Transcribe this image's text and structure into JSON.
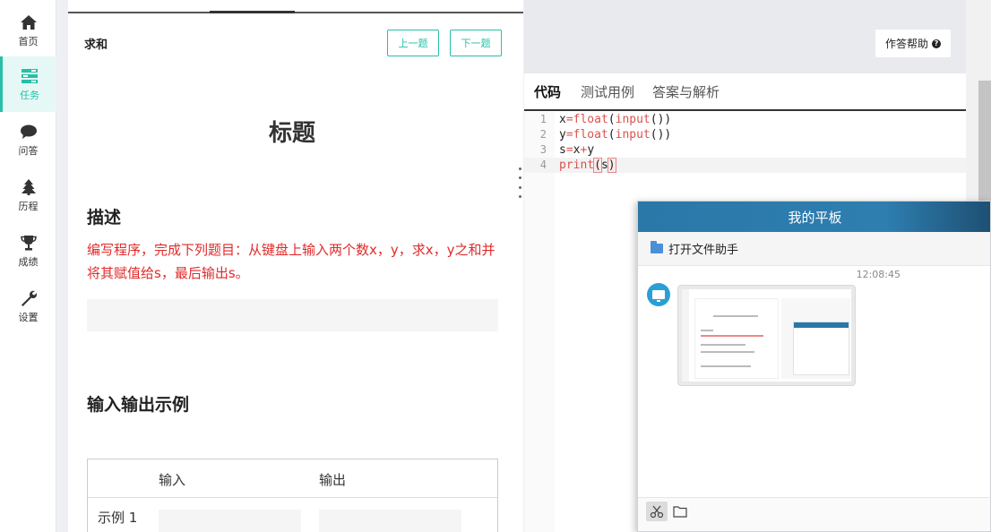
{
  "sidebar": {
    "items": [
      {
        "label": "首页",
        "icon": "home-icon"
      },
      {
        "label": "任务",
        "icon": "tasks-icon",
        "active": true
      },
      {
        "label": "问答",
        "icon": "chat-icon"
      },
      {
        "label": "历程",
        "icon": "tree-icon"
      },
      {
        "label": "成绩",
        "icon": "trophy-icon"
      },
      {
        "label": "设置",
        "icon": "wrench-icon"
      }
    ]
  },
  "problem": {
    "title": "求和",
    "prev_label": "上一题",
    "next_label": "下一题",
    "heading": "标题",
    "desc_heading": "描述",
    "description": "编写程序，完成下列题目：从键盘上输入两个数x，y，求x，y之和并将其赋值给s，最后输出s。",
    "io_heading": "输入输出示例",
    "table": {
      "input_header": "输入",
      "output_header": "输出",
      "row_label": "示例 1"
    }
  },
  "editor": {
    "help_label": "作答帮助",
    "tabs": [
      "代码",
      "测试用例",
      "答案与解析"
    ],
    "lines": [
      {
        "num": "1",
        "code": "x=float(input())"
      },
      {
        "num": "2",
        "code": "y=float(input())"
      },
      {
        "num": "3",
        "code": "s=x+y"
      },
      {
        "num": "4",
        "code": "print(s)"
      }
    ]
  },
  "chat": {
    "title": "我的平板",
    "file_helper": "打开文件助手",
    "time": "12:08:45"
  },
  "colors": {
    "accent": "#27bfa6",
    "description_red": "#e02a2a",
    "chat_header": "#2a78a8"
  }
}
